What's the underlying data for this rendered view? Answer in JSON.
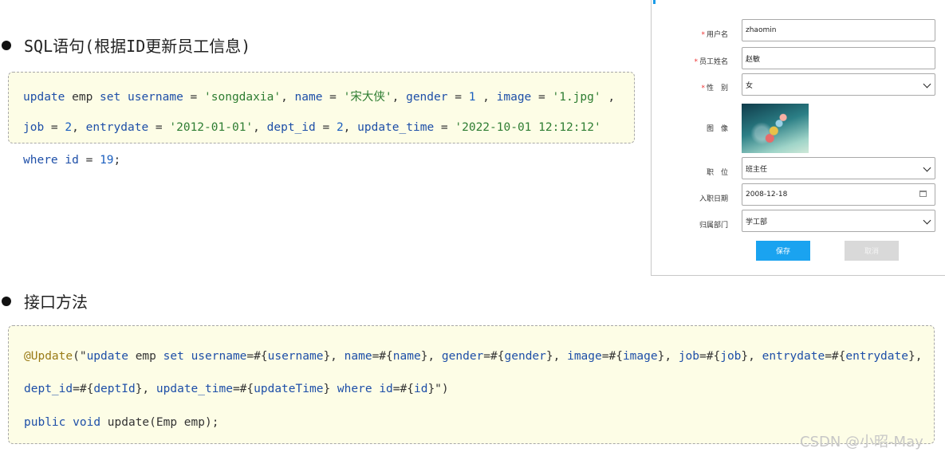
{
  "section1": {
    "title": "SQL语句(根据ID更新员工信息)",
    "line1": [
      {
        "t": "update",
        "c": "kw"
      },
      {
        "t": " emp ",
        "c": "plain"
      },
      {
        "t": "set",
        "c": "kw"
      },
      {
        "t": " ",
        "c": "plain"
      },
      {
        "t": "username",
        "c": "kw"
      },
      {
        "t": " = ",
        "c": "plain"
      },
      {
        "t": "'songdaxia'",
        "c": "str"
      },
      {
        "t": ", ",
        "c": "plain"
      },
      {
        "t": "name",
        "c": "kw"
      },
      {
        "t": " = ",
        "c": "plain"
      },
      {
        "t": "'宋大侠'",
        "c": "str"
      },
      {
        "t": ", ",
        "c": "plain"
      },
      {
        "t": "gender",
        "c": "kw"
      },
      {
        "t": " = ",
        "c": "plain"
      },
      {
        "t": "1",
        "c": "num"
      },
      {
        "t": " , ",
        "c": "plain"
      },
      {
        "t": "image",
        "c": "kw"
      },
      {
        "t": " = ",
        "c": "plain"
      },
      {
        "t": "'1.jpg'",
        "c": "str"
      },
      {
        "t": " ,",
        "c": "plain"
      }
    ],
    "line2": [
      {
        "t": "job",
        "c": "kw"
      },
      {
        "t": " = ",
        "c": "plain"
      },
      {
        "t": "2",
        "c": "num"
      },
      {
        "t": ", ",
        "c": "plain"
      },
      {
        "t": "entrydate",
        "c": "kw"
      },
      {
        "t": " = ",
        "c": "plain"
      },
      {
        "t": "'2012-01-01'",
        "c": "str"
      },
      {
        "t": ", ",
        "c": "plain"
      },
      {
        "t": "dept_id",
        "c": "kw"
      },
      {
        "t": " = ",
        "c": "plain"
      },
      {
        "t": "2",
        "c": "num"
      },
      {
        "t": ", ",
        "c": "plain"
      },
      {
        "t": "update_time",
        "c": "kw"
      },
      {
        "t": " = ",
        "c": "plain"
      },
      {
        "t": "'2022-10-01 12:12:12'",
        "c": "str"
      }
    ],
    "line3": [
      {
        "t": "where",
        "c": "kw"
      },
      {
        "t": " ",
        "c": "plain"
      },
      {
        "t": "id",
        "c": "kw"
      },
      {
        "t": " = ",
        "c": "plain"
      },
      {
        "t": "19",
        "c": "num"
      },
      {
        "t": ";",
        "c": "plain"
      }
    ]
  },
  "section2": {
    "title": "接口方法",
    "line1": [
      {
        "t": "@Update",
        "c": "ann"
      },
      {
        "t": "(\"",
        "c": "plain"
      },
      {
        "t": "update",
        "c": "kw"
      },
      {
        "t": " emp ",
        "c": "plain"
      },
      {
        "t": "set",
        "c": "kw"
      },
      {
        "t": " ",
        "c": "plain"
      },
      {
        "t": "username",
        "c": "kw"
      },
      {
        "t": "=#{",
        "c": "plain"
      },
      {
        "t": "username",
        "c": "kw"
      },
      {
        "t": "}, ",
        "c": "plain"
      },
      {
        "t": "name",
        "c": "kw"
      },
      {
        "t": "=#{",
        "c": "plain"
      },
      {
        "t": "name",
        "c": "kw"
      },
      {
        "t": "}, ",
        "c": "plain"
      },
      {
        "t": "gender",
        "c": "kw"
      },
      {
        "t": "=#{",
        "c": "plain"
      },
      {
        "t": "gender",
        "c": "kw"
      },
      {
        "t": "}, ",
        "c": "plain"
      },
      {
        "t": "image",
        "c": "kw"
      },
      {
        "t": "=#{",
        "c": "plain"
      },
      {
        "t": "image",
        "c": "kw"
      },
      {
        "t": "}, ",
        "c": "plain"
      },
      {
        "t": "job",
        "c": "kw"
      },
      {
        "t": "=#{",
        "c": "plain"
      },
      {
        "t": "job",
        "c": "kw"
      },
      {
        "t": "}, ",
        "c": "plain"
      },
      {
        "t": "entrydate",
        "c": "kw"
      },
      {
        "t": "=#{",
        "c": "plain"
      },
      {
        "t": "entrydate",
        "c": "kw"
      },
      {
        "t": "},",
        "c": "plain"
      }
    ],
    "line2": [
      {
        "t": "dept_id",
        "c": "kw"
      },
      {
        "t": "=#{",
        "c": "plain"
      },
      {
        "t": "deptId",
        "c": "kw"
      },
      {
        "t": "}, ",
        "c": "plain"
      },
      {
        "t": "update_time",
        "c": "kw"
      },
      {
        "t": "=#{",
        "c": "plain"
      },
      {
        "t": "updateTime",
        "c": "kw"
      },
      {
        "t": "} ",
        "c": "plain"
      },
      {
        "t": "where",
        "c": "kw"
      },
      {
        "t": " ",
        "c": "plain"
      },
      {
        "t": "id",
        "c": "kw"
      },
      {
        "t": "=#{",
        "c": "plain"
      },
      {
        "t": "id",
        "c": "kw"
      },
      {
        "t": "}\")",
        "c": "plain"
      }
    ],
    "line3": [
      {
        "t": "public",
        "c": "kw"
      },
      {
        "t": " ",
        "c": "plain"
      },
      {
        "t": "void",
        "c": "kw"
      },
      {
        "t": " update(Emp emp);",
        "c": "plain"
      }
    ]
  },
  "form": {
    "username_label": "用户名",
    "username_value": "zhaomin",
    "name_label": "员工姓名",
    "name_value": "赵敏",
    "gender_label": "性　别",
    "gender_value": "女",
    "image_label": "图　像",
    "job_label": "职　位",
    "job_value": "班主任",
    "entrydate_label": "入职日期",
    "entrydate_value": "2008-12-18",
    "dept_label": "归属部门",
    "dept_value": "学工部",
    "required_mark": "*",
    "save_label": "保存",
    "cancel_label": "取消"
  },
  "watermark": "CSDN @小昭-May",
  "colors": {
    "keyword": "#1e4fa8",
    "string": "#2e7d32",
    "annotation": "#9a7b16",
    "code_bg": "#fdfde6",
    "save_button": "#1aa3f0"
  }
}
